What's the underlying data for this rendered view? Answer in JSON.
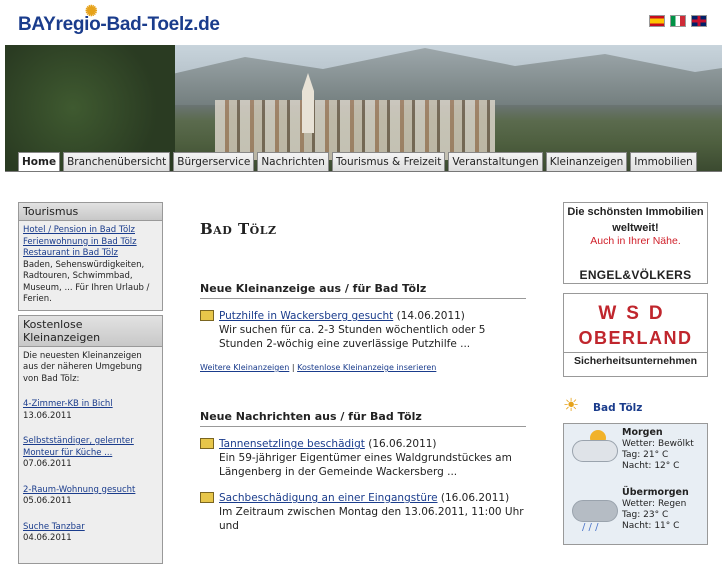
{
  "site": {
    "logo": "BAYregio-Bad-Toelz.de"
  },
  "flags": [
    {
      "name": "spanish-flag",
      "color": "#c60b1e"
    },
    {
      "name": "italian-flag",
      "color": "#009246"
    },
    {
      "name": "uk-flag",
      "color": "#012169"
    }
  ],
  "nav": {
    "tabs": [
      {
        "label": "Home",
        "active": true
      },
      {
        "label": "Branchenübersicht"
      },
      {
        "label": "Bürgerservice"
      },
      {
        "label": "Nachrichten"
      },
      {
        "label": "Tourismus & Freizeit"
      },
      {
        "label": "Veranstaltungen"
      },
      {
        "label": "Kleinanzeigen"
      },
      {
        "label": "Immobilien"
      }
    ]
  },
  "sidebar": {
    "tourismus": {
      "title": "Tourismus",
      "links": [
        "Hotel / Pension in Bad Tölz",
        "Ferienwohnung in Bad Tölz",
        "Restaurant in Bad Tölz"
      ],
      "text": "Baden, Sehenswürdigkeiten, Radtouren, Schwimmbad, Museum, ... Für Ihren Urlaub / Ferien."
    },
    "kleinanzeigen": {
      "title": "Kostenlose Kleinanzeigen",
      "intro": "Die neuesten Kleinanzeigen aus der näheren Umgebung von Bad Tölz:",
      "items": [
        {
          "title": "4-Zimmer-KB in Bichl",
          "date": "13.06.2011"
        },
        {
          "title": "Selbstständiger, gelernter Monteur für Küche ...",
          "date": "07.06.2011"
        },
        {
          "title": "2-Raum-Wohnung gesucht",
          "date": "05.06.2011"
        },
        {
          "title": "Suche Tanzbar",
          "date": "04.06.2011"
        }
      ]
    }
  },
  "main": {
    "title": "Bad Tölz",
    "kleinanzeige": {
      "heading": "Neue Kleinanzeige aus / für Bad Tölz",
      "entry": {
        "link": "Putzhilfe in Wackersberg gesucht",
        "date": "(14.06.2011)",
        "text": "Wir suchen für ca. 2-3 Stunden wöchentlich oder 5 Stunden 2-wöchig eine zuverlässige Putzhilfe ..."
      },
      "more_link": "Weitere Kleinanzeigen",
      "sep": "|",
      "insert_link": "Kostenlose Kleinanzeige inserieren"
    },
    "nachrichten": {
      "heading": "Neue Nachrichten aus / für Bad Tölz",
      "entries": [
        {
          "link": "Tannensetzlinge beschädigt",
          "date": "(16.06.2011)",
          "text": "Ein 59-jähriger Eigentümer eines Waldgrundstückes am Längenberg in der Gemeinde Wackersberg ..."
        },
        {
          "link": "Sachbeschädigung an einer Eingangstüre",
          "date": "(16.06.2011)",
          "text": "Im Zeitraum zwischen Montag den 13.06.2011, 11:00 Uhr und"
        }
      ]
    }
  },
  "right": {
    "ad_engel": {
      "line1": "Die schönsten Immobilien",
      "line2": "weltweit!",
      "line3": "Auch in Ihrer Nähe.",
      "brand": "ENGEL&VÖLKERS"
    },
    "ad_wsd": {
      "line1": "WSD",
      "line2": "OBERLAND",
      "line3": "Sicherheitsunternehmen"
    },
    "weather": {
      "location": "Bad Tölz",
      "days": [
        {
          "label": "Morgen",
          "wetter": "Wetter: Bewölkt",
          "tag": "Tag: 21° C",
          "nacht": "Nacht: 12° C"
        },
        {
          "label": "Übermorgen",
          "wetter": "Wetter: Regen",
          "tag": "Tag: 23° C",
          "nacht": "Nacht: 11° C"
        }
      ]
    }
  }
}
